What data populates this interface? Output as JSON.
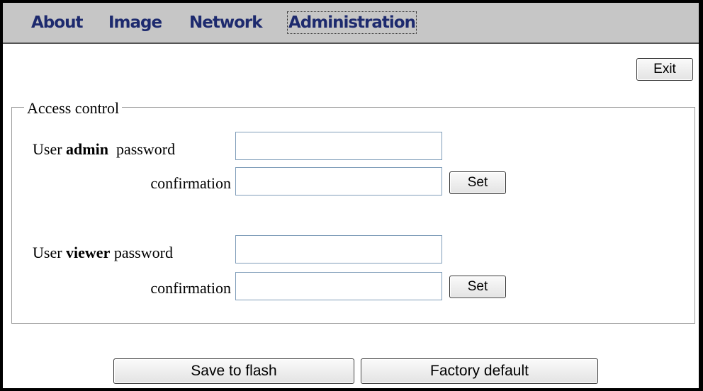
{
  "nav": {
    "items": [
      {
        "label": "About"
      },
      {
        "label": "Image"
      },
      {
        "label": "Network"
      },
      {
        "label": "Administration",
        "active": true
      }
    ]
  },
  "exit_label": "Exit",
  "access_control": {
    "legend": "Access control",
    "admin": {
      "prefix": "User",
      "user": "admin",
      "suffix": "password",
      "password_value": "",
      "confirmation_label": "confirmation",
      "confirmation_value": "",
      "set_label": "Set"
    },
    "viewer": {
      "prefix": "User",
      "user": "viewer",
      "suffix": "password",
      "password_value": "",
      "confirmation_label": "confirmation",
      "confirmation_value": "",
      "set_label": "Set"
    }
  },
  "footer": {
    "save_label": "Save to flash",
    "factory_label": "Factory default"
  },
  "colors": {
    "nav_background": "#c6c6c6",
    "nav_text": "#1d2a6e",
    "input_border": "#7f9db9"
  }
}
